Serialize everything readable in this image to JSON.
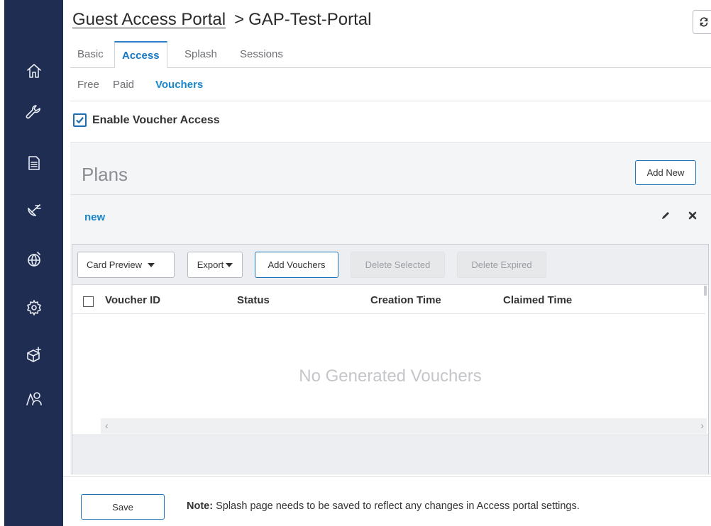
{
  "breadcrumb": {
    "root": "Guest Access Portal",
    "separator": ">",
    "current": "GAP-Test-Portal"
  },
  "nav_icons": [
    "home-icon",
    "wrench-icon",
    "report-icon",
    "satellite-icon",
    "globe-icon",
    "gear-icon",
    "box-add-icon",
    "users-icon"
  ],
  "tabs": [
    {
      "label": "Basic",
      "active": false
    },
    {
      "label": "Access",
      "active": true
    },
    {
      "label": "Splash",
      "active": false
    },
    {
      "label": "Sessions",
      "active": false
    }
  ],
  "subtabs": [
    {
      "label": "Free",
      "active": false
    },
    {
      "label": "Paid",
      "active": false
    },
    {
      "label": "Vouchers",
      "active": true
    }
  ],
  "enable_voucher": {
    "label": "Enable Voucher Access",
    "checked": true
  },
  "plans": {
    "title": "Plans",
    "add_new_label": "Add New",
    "plan_name": "new"
  },
  "voucher_toolbar": {
    "card_preview": "Card Preview",
    "export": "Export",
    "add_vouchers": "Add Vouchers",
    "delete_selected": "Delete Selected",
    "delete_expired": "Delete Expired"
  },
  "voucher_table": {
    "columns": [
      "Voucher ID",
      "Status",
      "Creation Time",
      "Claimed Time"
    ],
    "rows": [],
    "empty_message": "No Generated Vouchers"
  },
  "footer": {
    "save_label": "Save",
    "note_label": "Note:",
    "note_text": "Splash page needs to be saved to reflect any changes in Access portal settings."
  },
  "colors": {
    "nav_bg": "#1f2d52",
    "accent": "#1a86cc",
    "button_border": "#1d73b8"
  }
}
